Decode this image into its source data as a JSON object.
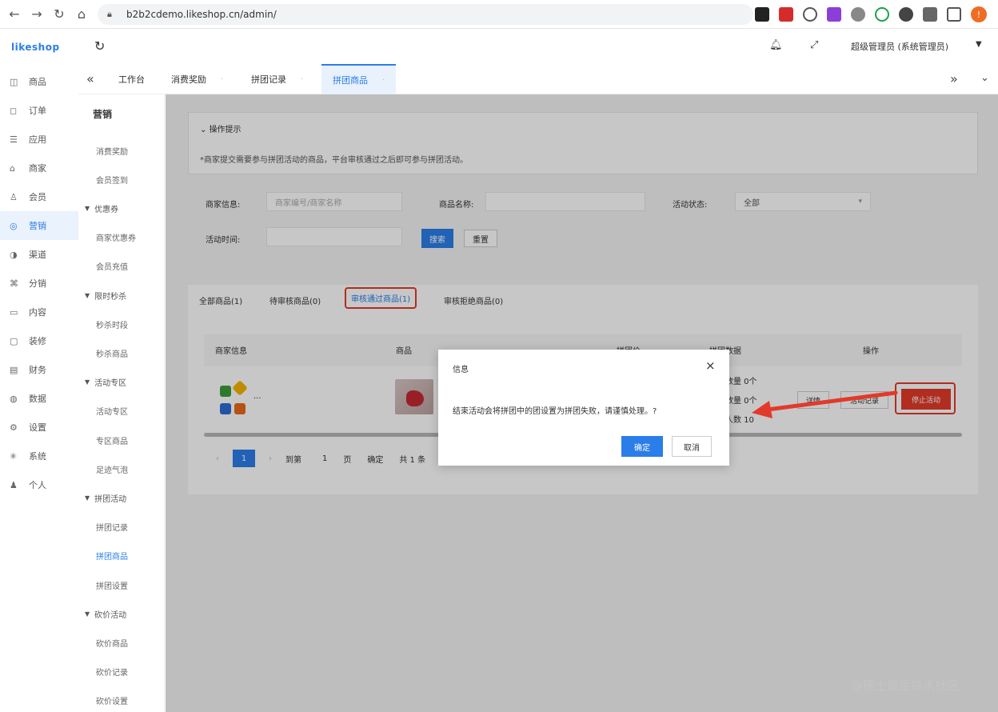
{
  "browser": {
    "url": "b2b2cdemo.likeshop.cn/admin/",
    "profile_initial": "!"
  },
  "app": {
    "logo": "likeshop"
  },
  "header": {
    "user": "超级管理员 (系统管理员)"
  },
  "sidebar": {
    "items": [
      {
        "label": "商品",
        "icon": "cart-icon"
      },
      {
        "label": "订单",
        "icon": "order-icon"
      },
      {
        "label": "应用",
        "icon": "app-icon"
      },
      {
        "label": "商家",
        "icon": "shop-icon"
      },
      {
        "label": "会员",
        "icon": "user-icon"
      },
      {
        "label": "营销",
        "icon": "marketing-icon"
      },
      {
        "label": "渠道",
        "icon": "channel-icon"
      },
      {
        "label": "分销",
        "icon": "distribution-icon"
      },
      {
        "label": "内容",
        "icon": "content-icon"
      },
      {
        "label": "装修",
        "icon": "decor-icon"
      },
      {
        "label": "财务",
        "icon": "finance-icon"
      },
      {
        "label": "数据",
        "icon": "data-icon"
      },
      {
        "label": "设置",
        "icon": "settings-icon"
      },
      {
        "label": "系统",
        "icon": "system-icon"
      },
      {
        "label": "个人",
        "icon": "person-icon"
      }
    ]
  },
  "subnav": {
    "title": "营销",
    "rows": [
      {
        "label": "消费奖励",
        "type": "child"
      },
      {
        "label": "会员签到",
        "type": "child"
      },
      {
        "label": "优惠券",
        "type": "group"
      },
      {
        "label": "商家优惠券",
        "type": "child"
      },
      {
        "label": "会员充值",
        "type": "child"
      },
      {
        "label": "限时秒杀",
        "type": "group"
      },
      {
        "label": "秒杀时段",
        "type": "child"
      },
      {
        "label": "秒杀商品",
        "type": "child"
      },
      {
        "label": "活动专区",
        "type": "group"
      },
      {
        "label": "活动专区",
        "type": "child"
      },
      {
        "label": "专区商品",
        "type": "child"
      },
      {
        "label": "足迹气泡",
        "type": "child"
      },
      {
        "label": "拼团活动",
        "type": "group"
      },
      {
        "label": "拼团记录",
        "type": "child"
      },
      {
        "label": "拼团商品",
        "type": "child"
      },
      {
        "label": "拼团设置",
        "type": "child"
      },
      {
        "label": "砍价活动",
        "type": "group"
      },
      {
        "label": "砍价商品",
        "type": "child"
      },
      {
        "label": "砍价记录",
        "type": "child"
      },
      {
        "label": "砍价设置",
        "type": "child"
      }
    ]
  },
  "tabs": [
    "工作台",
    "消费奖励",
    "拼团记录",
    "拼团商品"
  ],
  "tip": {
    "title": "操作提示",
    "text": "*商家提交需要参与拼团活动的商品，平台审核通过之后即可参与拼团活动。"
  },
  "filters": {
    "shop_label": "商家信息:",
    "shop_placeholder": "商家编号/商家名称",
    "goods_label": "商品名称:",
    "status_label": "活动状态:",
    "status_value": "全部",
    "time_label": "活动时间:",
    "search_btn": "搜索",
    "reset_btn": "重置"
  },
  "status_tabs": [
    "全部商品(1)",
    "待审核商品(0)",
    "审核通过商品(1)",
    "审核拒绝商品(0)"
  ],
  "table": {
    "headers": [
      "商家信息",
      "商品",
      "拼团价",
      "拼团数据",
      "操作"
    ],
    "shop_more": "...",
    "stats": [
      "数量 0个",
      "数量 0个",
      "人数 10"
    ],
    "ops": [
      "详情",
      "活动记录",
      "停止活动"
    ]
  },
  "pager": {
    "current": "1",
    "goto": "到第",
    "page_value": "1",
    "page_unit": "页",
    "confirm": "确定",
    "total": "共 1 条"
  },
  "modal": {
    "title": "信息",
    "message": "结束活动会将拼团中的团设置为拼团失败，请谨慎处理。?",
    "ok": "确定",
    "cancel": "取消"
  },
  "watermark": "@稀土掘金技术社区",
  "colors": {
    "primary": "#2b7de9",
    "highlight": "#e23a2a"
  }
}
